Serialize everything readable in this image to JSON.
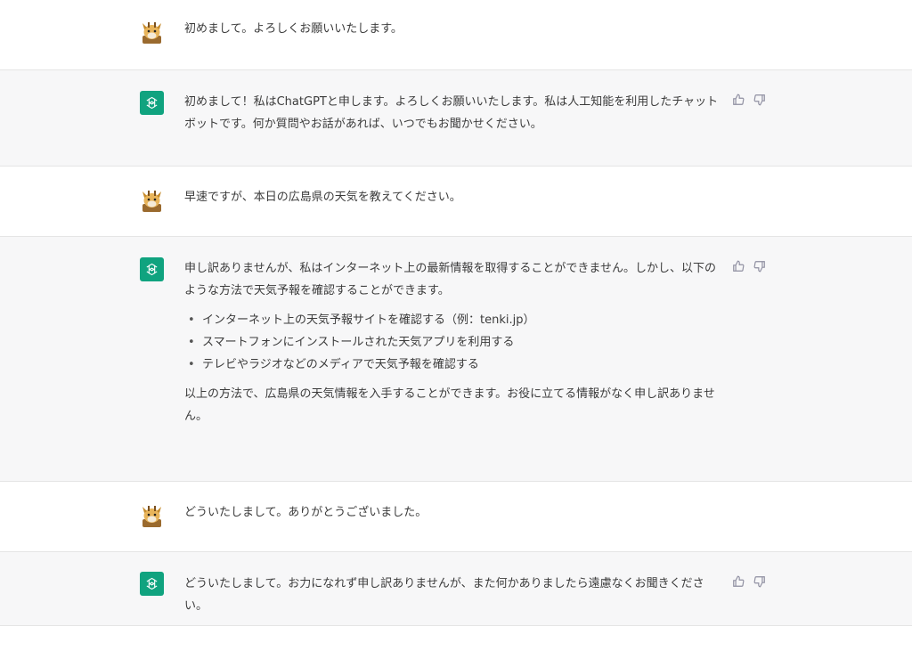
{
  "messages": [
    {
      "role": "user",
      "text": "初めまして。よろしくお願いいたします。"
    },
    {
      "role": "assistant",
      "text": "初めまして！私はChatGPTと申します。よろしくお願いいたします。私は人工知能を利用したチャットボットです。何か質問やお話があれば、いつでもお聞かせください。"
    },
    {
      "role": "user",
      "text": "早速ですが、本日の広島県の天気を教えてください。"
    },
    {
      "role": "assistant",
      "intro": "申し訳ありませんが、私はインターネット上の最新情報を取得することができません。しかし、以下のような方法で天気予報を確認することができます。",
      "bullets": [
        "インターネット上の天気予報サイトを確認する（例：tenki.jp）",
        "スマートフォンにインストールされた天気アプリを利用する",
        "テレビやラジオなどのメディアで天気予報を確認する"
      ],
      "outro": "以上の方法で、広島県の天気情報を入手することができます。お役に立てる情報がなく申し訳ありません。"
    },
    {
      "role": "user",
      "text": "どういたしまして。ありがとうございました。"
    },
    {
      "role": "assistant",
      "text": "どういたしまして。お力になれず申し訳ありませんが、また何かありましたら遠慮なくお聞きください。"
    }
  ],
  "icons": {
    "user_avatar": "giraffe-avatar-icon",
    "assistant_avatar": "chatgpt-logo-icon",
    "thumbs_up": "thumbs-up-icon",
    "thumbs_down": "thumbs-down-icon"
  },
  "colors": {
    "assistant_bg": "#f7f7f8",
    "user_bg": "#ffffff",
    "brand": "#10a37f"
  }
}
